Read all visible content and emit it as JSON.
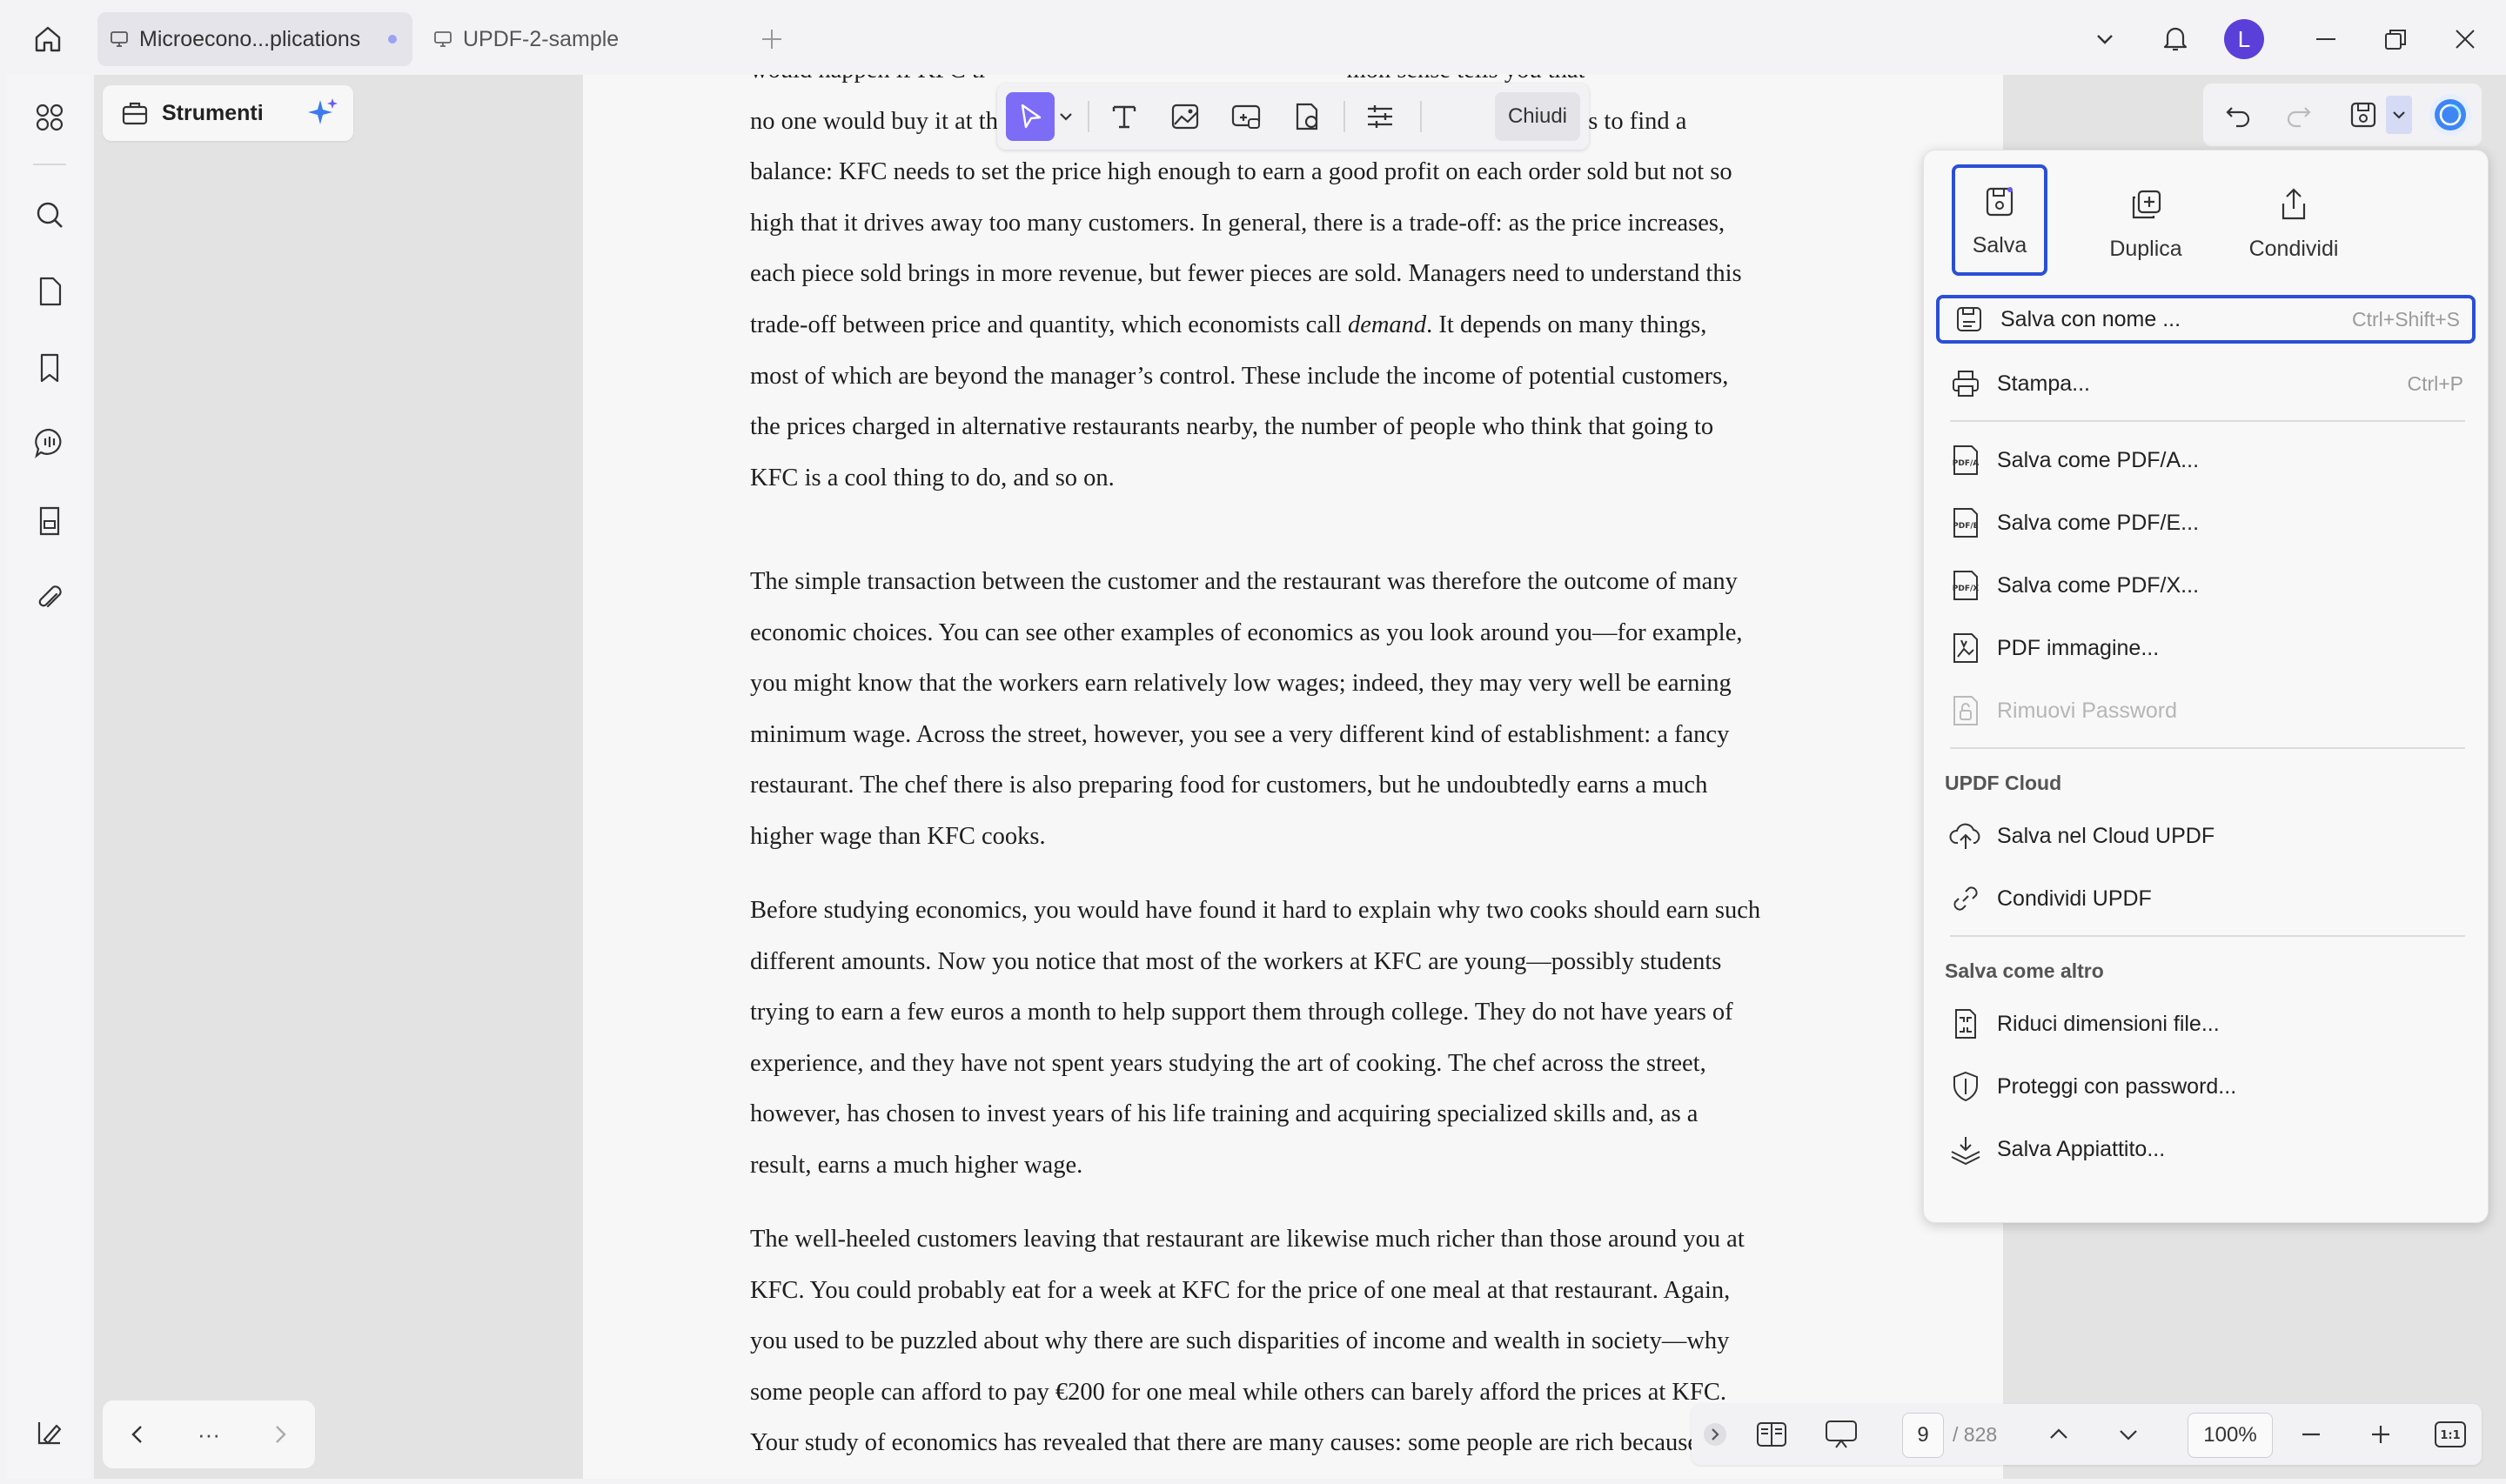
{
  "titlebar": {
    "tabs": [
      {
        "label": "Microecono...plications",
        "active": true,
        "unsaved": true
      },
      {
        "label": "UPDF-2-sample",
        "active": false
      }
    ],
    "avatar_letter": "L"
  },
  "left_panel": {
    "tools_label": "Strumenti",
    "nav_more": "···"
  },
  "edit_toolbar": {
    "close_label": "Chiudi"
  },
  "document": {
    "paragraphs": [
      {
        "lines": [
          "would happen if KFC tr                                                          mon sense tells you that",
          "no one would buy it at that price. Now you understand that the challenge of pricing is to find a",
          "balance: KFC needs to set the price high enough to earn a good profit on each order sold but not so",
          "high that it drives away too many customers. In general, there is a trade-off: as the price increases,",
          "each piece sold brings in more revenue, but fewer pieces are sold. Managers need to understand this",
          "trade-off between price and quantity, which economists call demand. It depends on many things,",
          "most of which are beyond the manager’s control. These include the income of potential customers,",
          "the prices charged in alternative restaurants nearby, the number of people who think that going to",
          "KFC is a cool thing to do, and so on."
        ]
      },
      {
        "lines": [
          "The simple transaction between the customer and the restaurant was therefore the outcome of many",
          "economic choices. You can see other examples of economics as you look around you—for example,",
          "you might know that the workers earn relatively low wages; indeed, they may very well be earning",
          "minimum wage. Across the street, however, you see a very different kind of establishment: a fancy",
          "restaurant. The chef there is also preparing food for customers, but he undoubtedly earns a much",
          "higher wage than KFC cooks."
        ]
      },
      {
        "lines": [
          "Before studying economics, you would have found it hard to explain why two cooks should earn such",
          "different amounts. Now you notice that most of the workers at KFC are young—possibly students",
          "trying to earn a few euros a month to help support them through college. They do not have years of",
          "experience, and they have not spent years studying the art of cooking. The chef across the street,",
          "however, has chosen to invest years of his life training and acquiring specialized skills and, as a",
          "result, earns a much higher wage."
        ]
      },
      {
        "lines": [
          "The well-heeled customers leaving that restaurant are likewise much richer than those around you at",
          "KFC. You could probably eat for a week at KFC for the price of one meal at that restaurant. Again,",
          "you used to be puzzled about why there are such disparities of income and wealth in society—why",
          "some people can afford to pay €200 for one meal while others can barely afford the prices at KFC.",
          "Your study of economics has revealed that there are many causes: some people are rich because"
        ]
      }
    ]
  },
  "save_menu": {
    "top": [
      {
        "label": "Salva",
        "icon": "save-icon"
      },
      {
        "label": "Duplica",
        "icon": "duplicate-icon"
      },
      {
        "label": "Condividi",
        "icon": "share-icon"
      }
    ],
    "items": [
      {
        "label": "Salva con nome ...",
        "shortcut": "Ctrl+Shift+S",
        "icon": "save-as-icon",
        "highlighted": true
      },
      {
        "label": "Stampa...",
        "shortcut": "Ctrl+P",
        "icon": "print-icon"
      },
      {
        "label": "Salva come PDF/A...",
        "icon": "pdfa-icon"
      },
      {
        "label": "Salva come PDF/E...",
        "icon": "pdfe-icon"
      },
      {
        "label": "Salva come PDF/X...",
        "icon": "pdfx-icon"
      },
      {
        "label": "PDF immagine...",
        "icon": "pdf-image-icon"
      },
      {
        "label": "Rimuovi Password",
        "icon": "remove-password-icon",
        "disabled": true
      }
    ],
    "cloud_heading": "UPDF Cloud",
    "cloud_items": [
      {
        "label": "Salva nel Cloud UPDF",
        "icon": "cloud-upload-icon"
      },
      {
        "label": "Condividi UPDF",
        "icon": "link-icon"
      }
    ],
    "other_heading": "Salva come altro",
    "other_items": [
      {
        "label": "Riduci dimensioni file...",
        "icon": "compress-icon"
      },
      {
        "label": "Proteggi con password...",
        "icon": "protect-icon"
      },
      {
        "label": "Salva Appiattito...",
        "icon": "flatten-icon"
      }
    ]
  },
  "statusbar": {
    "current_page": "9",
    "total_pages": "/ 828",
    "zoom": "100%",
    "fit_label": "1:1"
  }
}
